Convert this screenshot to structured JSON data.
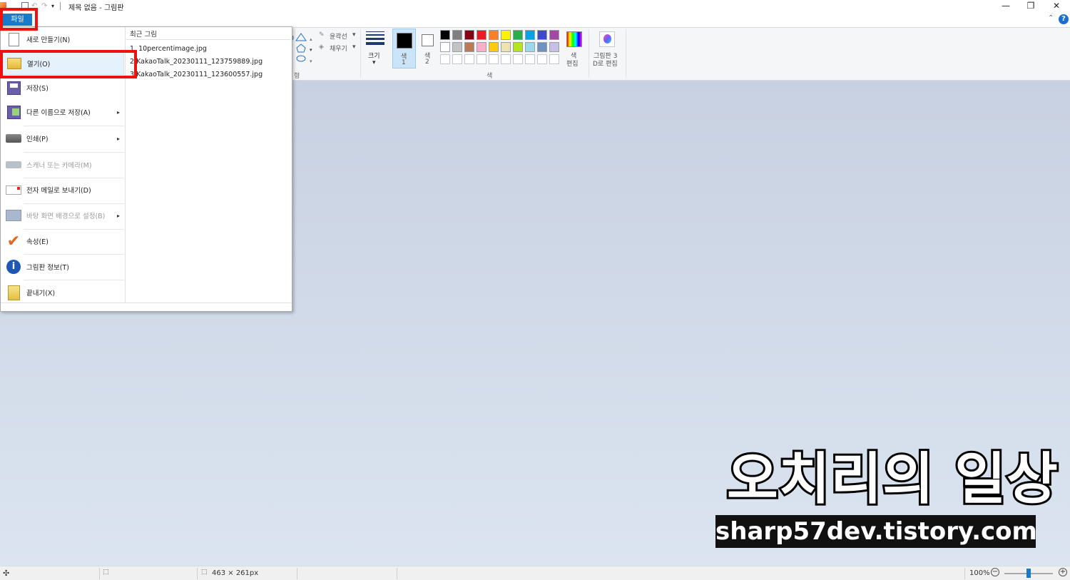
{
  "window": {
    "title": "제목 없음 - 그림판",
    "minimize_icon": "minimize-icon",
    "restore_icon": "restore-icon",
    "close_icon": "close-icon"
  },
  "tabs": {
    "file_tab": "파일"
  },
  "ribbon": {
    "outline_label": "윤곽선",
    "fill_label": "채우기",
    "size_label": "크기",
    "color1_label": "색\n1",
    "color1_top": "색",
    "color1_bottom": "1",
    "color2_top": "색",
    "color2_bottom": "2",
    "edit_colors_top": "색",
    "edit_colors_bottom": "편집",
    "paint3d_top": "그림판 3",
    "paint3d_bottom": "D로 편집",
    "colors_group": "색",
    "shapes_group_partial": "형",
    "palette_row1": [
      "#000000",
      "#7f7f7f",
      "#880015",
      "#ed1c24",
      "#ff7f27",
      "#fff200",
      "#22b14c",
      "#00a2e8",
      "#3f48cc",
      "#a349a4"
    ],
    "palette_row2": [
      "#ffffff",
      "#c3c3c3",
      "#b97a57",
      "#ffaec9",
      "#ffc90e",
      "#efe4b0",
      "#b5e61d",
      "#99d9ea",
      "#7092be",
      "#c8bfe7"
    ]
  },
  "file_menu": {
    "items": [
      {
        "label": "새로 만들기(N)",
        "icon": "new-file-icon",
        "enabled": true
      },
      {
        "label": "열기(O)",
        "icon": "open-folder-icon",
        "enabled": true
      },
      {
        "label": "저장(S)",
        "icon": "save-disk-icon",
        "enabled": true
      },
      {
        "label": "다른 이름으로 저장(A)",
        "icon": "save-as-icon",
        "enabled": true
      },
      {
        "label": "인쇄(P)",
        "icon": "printer-icon",
        "enabled": true
      },
      {
        "label": "스캐너 또는 카메라(M)",
        "icon": "scanner-icon",
        "enabled": false
      },
      {
        "label": "전자 메일로 보내기(D)",
        "icon": "email-icon",
        "enabled": true
      },
      {
        "label": "바탕 화면 배경으로 설정(B)",
        "icon": "desktop-background-icon",
        "enabled": false
      },
      {
        "label": "속성(E)",
        "icon": "checkmark-icon",
        "enabled": true
      },
      {
        "label": "그림판 정보(T)",
        "icon": "info-icon",
        "enabled": true
      },
      {
        "label": "끝내기(X)",
        "icon": "exit-icon",
        "enabled": true
      }
    ],
    "recent_title": "최근 그림",
    "recent": [
      {
        "num": "1",
        "name": "10percentimage.jpg"
      },
      {
        "num": "2",
        "name": "KakaoTalk_20230111_123759889.jpg"
      },
      {
        "num": "3",
        "name": "KakaoTalk_20230111_123600557.jpg"
      }
    ]
  },
  "statusbar": {
    "image_size": "463 × 261px",
    "zoom": "100%"
  },
  "watermark": {
    "top_text": "오치리의 일상",
    "bottom_text": "sharp57dev.tistory.com"
  },
  "colors": {
    "accent": "#1979ca",
    "highlight_red": "#ee1111"
  }
}
